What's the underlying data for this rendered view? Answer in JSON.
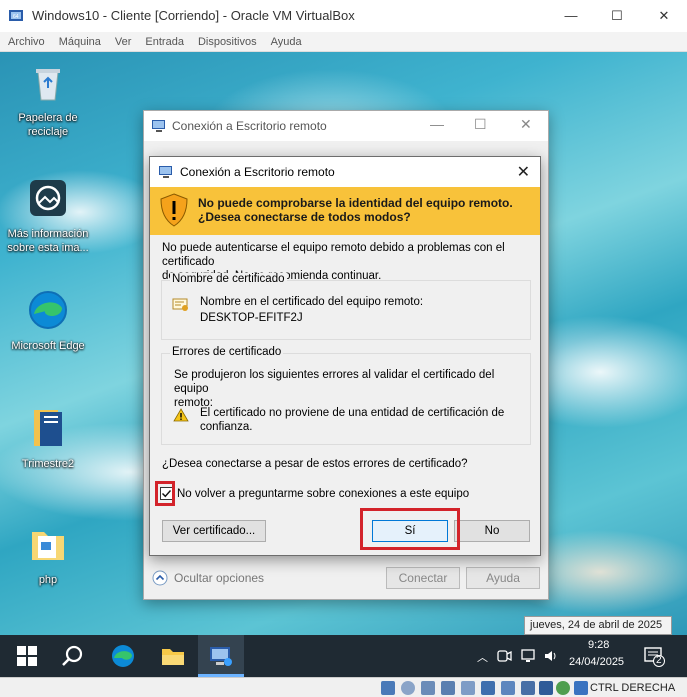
{
  "vbox": {
    "title": "Windows10 - Cliente [Corriendo] - Oracle VM VirtualBox",
    "menu": [
      "Archivo",
      "Máquina",
      "Ver",
      "Entrada",
      "Dispositivos",
      "Ayuda"
    ],
    "minimize": "—",
    "maximize": "☐",
    "close": "✕",
    "host_key": "CTRL DERECHA"
  },
  "desktop_icons": [
    {
      "label": "Papelera de reciclaje",
      "icon": "recycle-bin-icon"
    },
    {
      "label": "Más información sobre esta ima...",
      "icon": "info-camera-icon"
    },
    {
      "label": "Microsoft Edge",
      "icon": "edge-icon"
    },
    {
      "label": "Trimestre2",
      "icon": "document-icon"
    },
    {
      "label": "php",
      "icon": "folder-icon"
    }
  ],
  "rdp_window": {
    "title": "Conexión a Escritorio remoto",
    "hide_options": "Ocultar opciones",
    "connect": "Conectar",
    "help": "Ayuda"
  },
  "dialog": {
    "title": "Conexión a Escritorio remoto",
    "warning_line1": "No puede comprobarse la identidad del equipo remoto.",
    "warning_line2": "¿Desea conectarse de todos modos?",
    "intro_line1": "No puede autenticarse el equipo remoto debido a problemas con el certificado",
    "intro_line2": "de seguridad. No se recomienda continuar.",
    "cert_name_group": "Nombre de certificado",
    "cert_name_label": "Nombre en el certificado del equipo remoto:",
    "cert_name_value": "DESKTOP-EFITF2J",
    "cert_errors_group": "Errores de certificado",
    "errors_intro_line1": "Se produjeron los siguientes errores al validar el certificado del equipo",
    "errors_intro_line2": "remoto:",
    "error_line1": "El certificado no proviene de una entidad de certificación de",
    "error_line2": "confianza.",
    "question": "¿Desea conectarse a pesar de estos errores de certificado?",
    "dont_ask": "No volver a preguntarme sobre conexiones a este equipo",
    "view_cert": "Ver certificado...",
    "yes": "Sí",
    "no": "No",
    "checked": true
  },
  "taskbar": {
    "time": "9:28",
    "date": "24/04/2025",
    "tooltip": "jueves, 24 de abril de 2025",
    "notifications": "2"
  }
}
